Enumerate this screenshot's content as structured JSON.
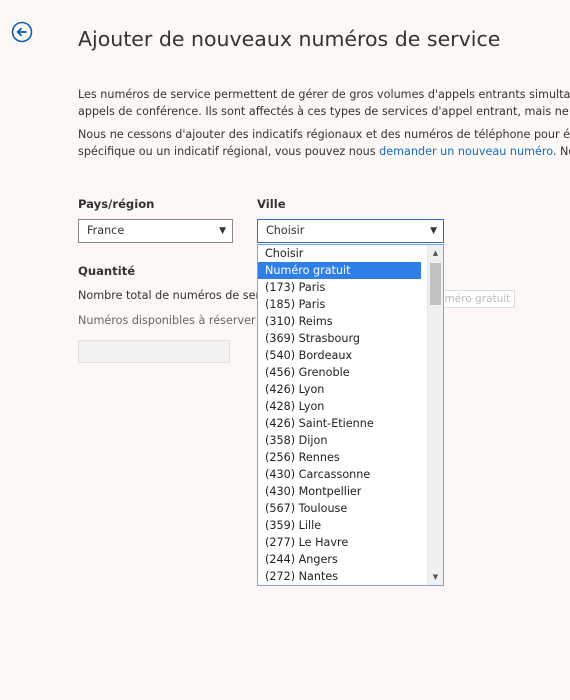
{
  "header": {
    "title": "Ajouter de nouveaux numéros de service"
  },
  "description": {
    "p1_line1": "Les numéros de service permettent de gérer de gros volumes d'appels entrants simultané",
    "p1_line2": "appels de conférence. Ils sont affectés à ces types de services d'appel entrant, mais ne peuven",
    "p2_line1": "Nous ne cessons d'ajouter des indicatifs régionaux et des numéros de téléphone pour éten",
    "p2_line2_before": "spécifique ou un indicatif régional, vous pouvez nous ",
    "p2_link": "demander un nouveau numéro",
    "p2_line2_after": ". Nous v"
  },
  "country": {
    "label": "Pays/région",
    "value": "France"
  },
  "city": {
    "label": "Ville",
    "value": "Choisir",
    "options": [
      "Choisir",
      "Numéro gratuit",
      "(173) Paris",
      "(185) Paris",
      "(310) Reims",
      "(369) Strasbourg",
      "(540) Bordeaux",
      "(456) Grenoble",
      "(426) Lyon",
      "(428) Lyon",
      "(426) Saint-Etienne",
      "(358) Dijon",
      "(256) Rennes",
      "(430) Carcassonne",
      "(430) Montpellier",
      "(567) Toulouse",
      "(359) Lille",
      "(277) Le Havre",
      "(244) Angers",
      "(272) Nantes"
    ],
    "highlighted": "Numéro gratuit",
    "tooltip": "Numéro gratuit"
  },
  "quantity": {
    "label": "Quantité",
    "total_label": "Nombre total de numéros de serv",
    "available_label": "Numéros disponibles à réserver m"
  }
}
